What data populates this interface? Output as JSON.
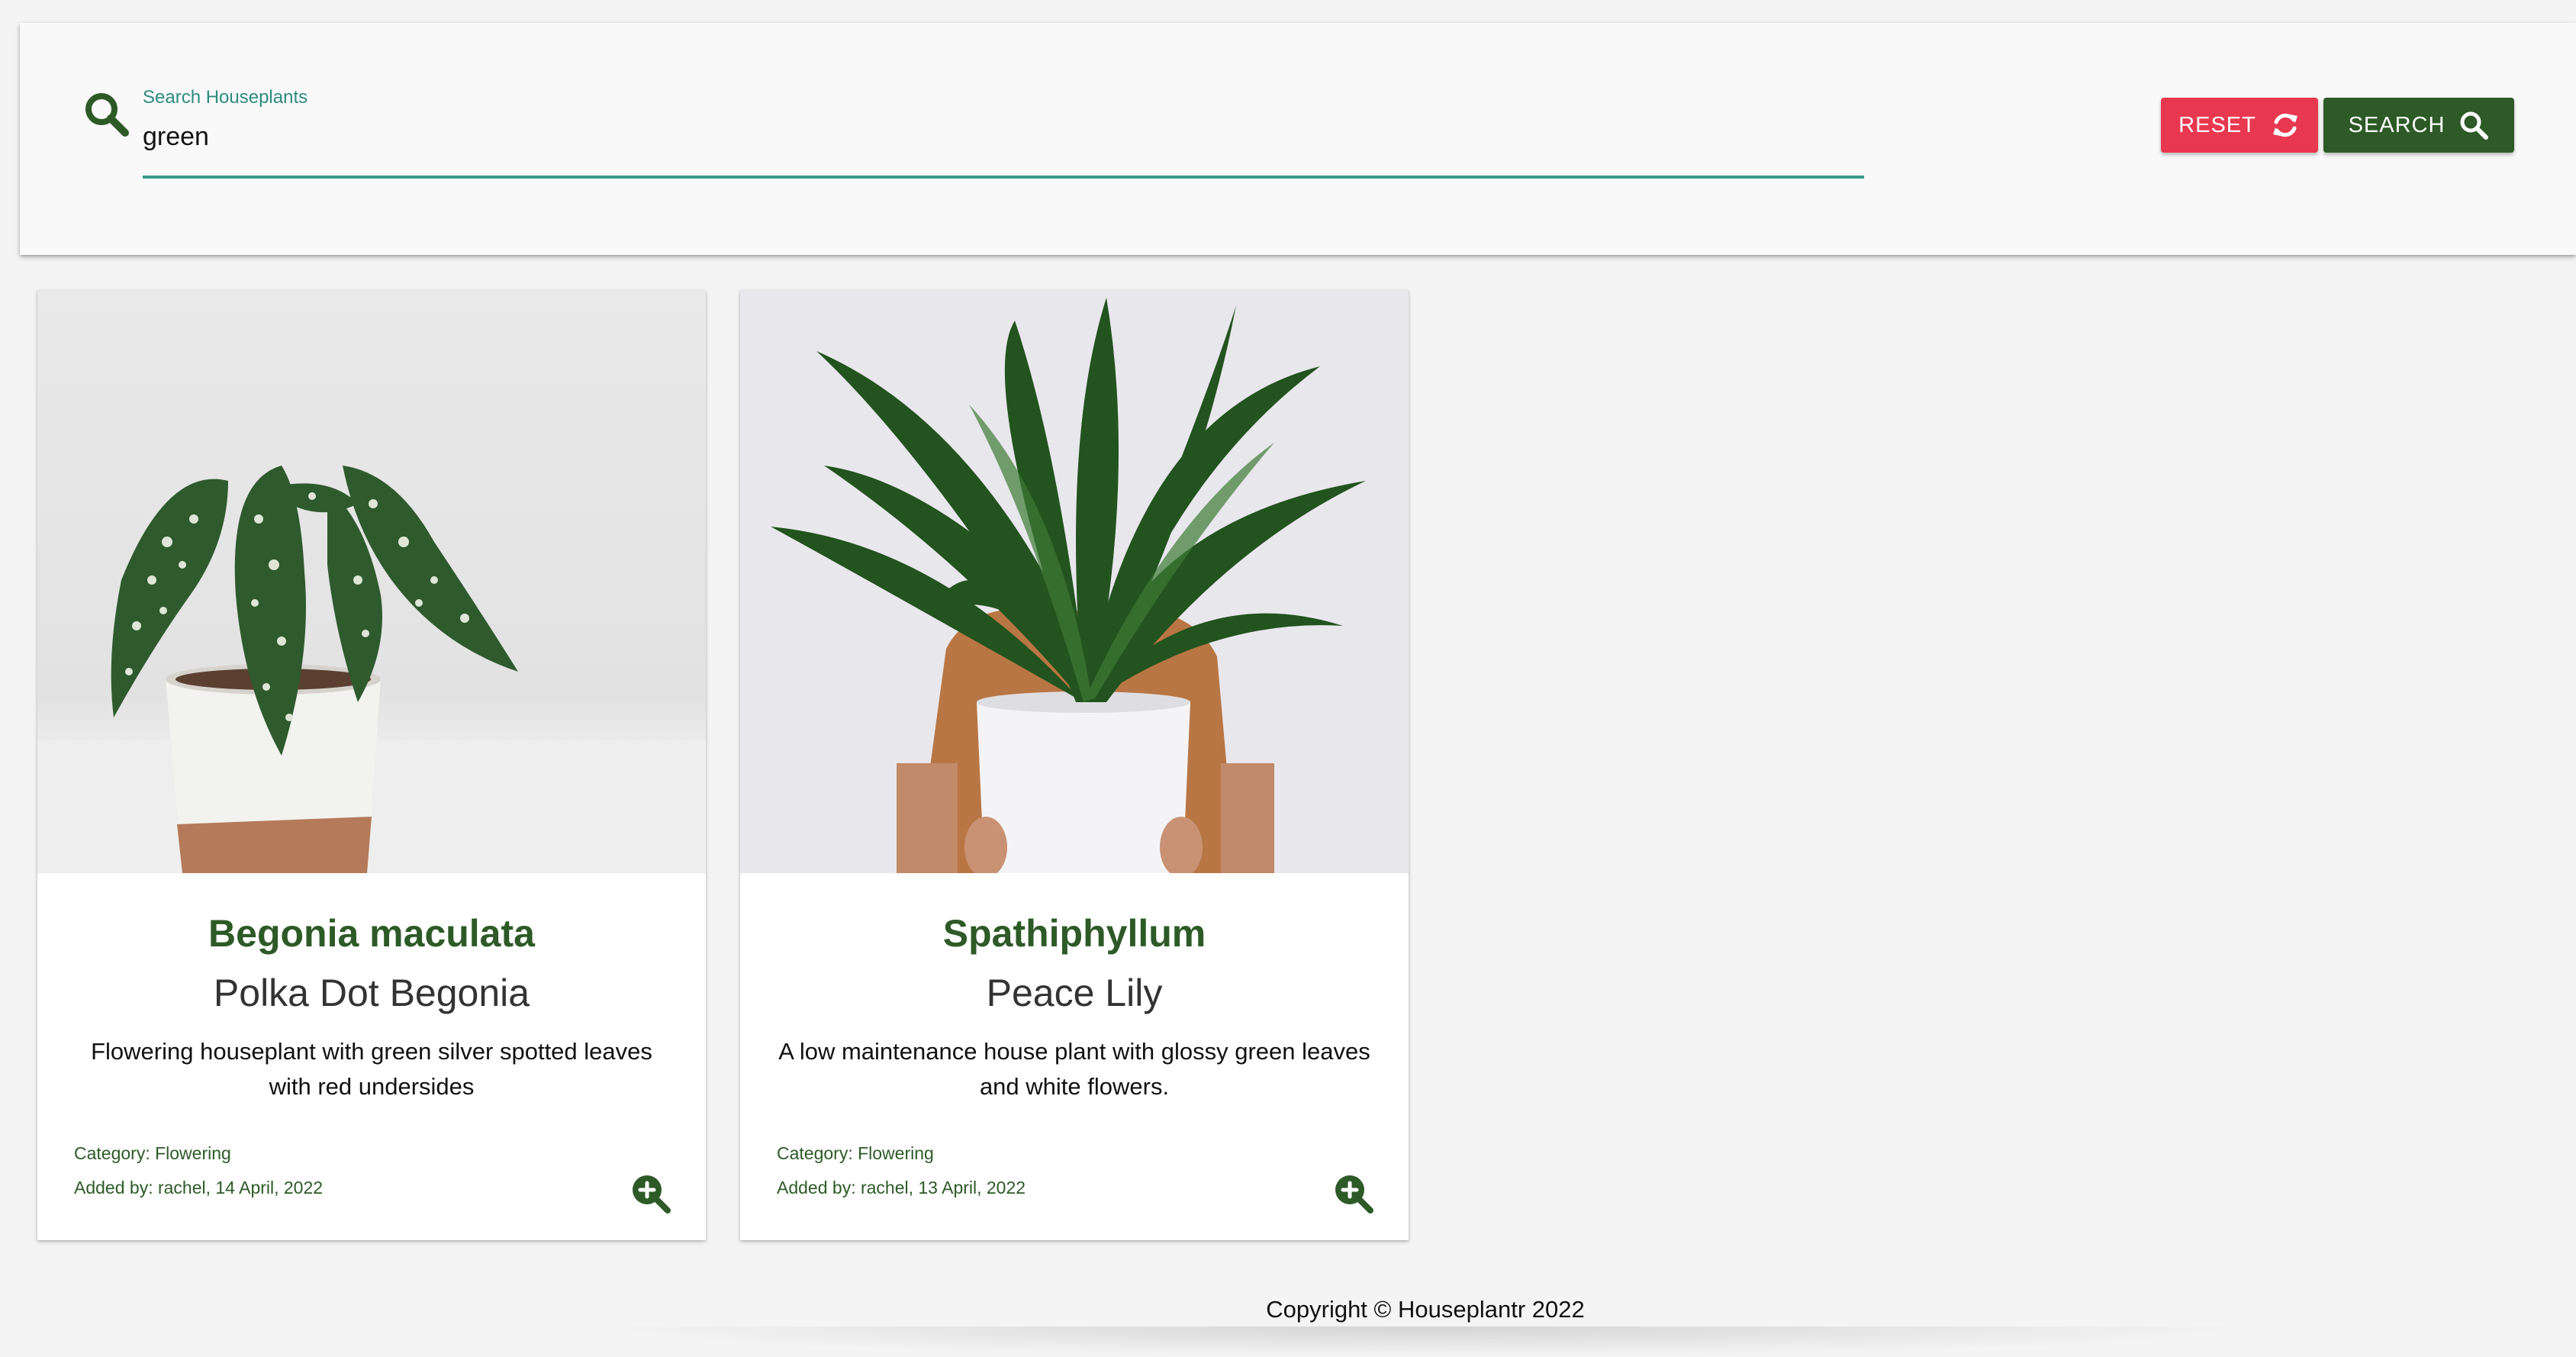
{
  "search": {
    "label": "Search Houseplants",
    "value": "green",
    "reset_label": "RESET",
    "search_label": "SEARCH"
  },
  "colors": {
    "accent_green": "#2d5a27",
    "reset_red": "#e8384f",
    "input_underline": "#3a9b8c"
  },
  "icons": {
    "search_prefix": "search-icon",
    "reset": "refresh-icon",
    "search_button": "search-icon",
    "card_detail": "zoom-in-icon"
  },
  "cards": [
    {
      "title": "Begonia maculata",
      "subtitle": "Polka Dot Begonia",
      "description": "Flowering houseplant with green silver spotted leaves with red undersides",
      "category": "Category: Flowering",
      "added": "Added by: rachel, 14 April, 2022"
    },
    {
      "title": "Spathiphyllum",
      "subtitle": "Peace Lily",
      "description": "A low maintenance house plant with glossy green leaves and white flowers.",
      "category": "Category: Flowering",
      "added": "Added by: rachel, 13 April, 2022"
    }
  ],
  "footer": {
    "copyright": "Copyright © Houseplantr 2022"
  }
}
